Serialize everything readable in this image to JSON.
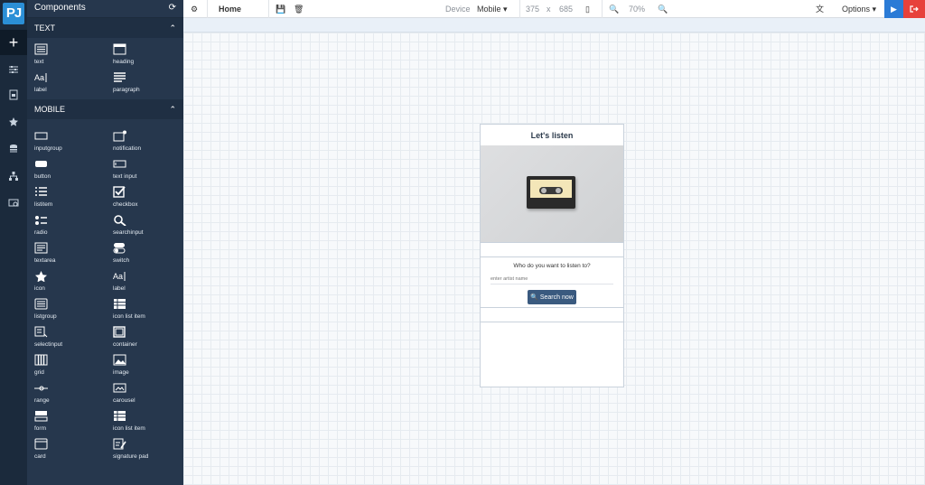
{
  "logo": "PJ",
  "rail": [
    {
      "name": "add-icon",
      "glyph": "+"
    },
    {
      "name": "sliders-icon"
    },
    {
      "name": "page-icon"
    },
    {
      "name": "star-icon"
    },
    {
      "name": "database-icon"
    },
    {
      "name": "sitemap-icon"
    },
    {
      "name": "preview-icon"
    }
  ],
  "panel": {
    "title": "Components",
    "refresh_icon": "refresh-icon"
  },
  "sections": [
    {
      "title": "TEXT",
      "items": [
        {
          "label": "text",
          "icon": "text"
        },
        {
          "label": "heading",
          "icon": "heading"
        },
        {
          "label": "label",
          "icon": "label"
        },
        {
          "label": "paragraph",
          "icon": "paragraph"
        }
      ]
    },
    {
      "title": "MOBILE",
      "items": [
        {
          "label": "inputgroup",
          "icon": "inputgroup"
        },
        {
          "label": "notification",
          "icon": "notification"
        },
        {
          "label": "button",
          "icon": "button"
        },
        {
          "label": "text input",
          "icon": "textinput"
        },
        {
          "label": "listitem",
          "icon": "list"
        },
        {
          "label": "checkbox",
          "icon": "checkbox"
        },
        {
          "label": "radio",
          "icon": "radio"
        },
        {
          "label": "searchinput",
          "icon": "search"
        },
        {
          "label": "textarea",
          "icon": "textarea"
        },
        {
          "label": "switch",
          "icon": "switch"
        },
        {
          "label": "icon",
          "icon": "star"
        },
        {
          "label": "label",
          "icon": "label"
        },
        {
          "label": "listgroup",
          "icon": "listgroup"
        },
        {
          "label": "icon list item",
          "icon": "table"
        },
        {
          "label": "selectinput",
          "icon": "selectinput"
        },
        {
          "label": "container",
          "icon": "container"
        },
        {
          "label": "grid",
          "icon": "grid"
        },
        {
          "label": "image",
          "icon": "image"
        },
        {
          "label": "range",
          "icon": "range"
        },
        {
          "label": "carousel",
          "icon": "carousel"
        },
        {
          "label": "form",
          "icon": "form"
        },
        {
          "label": "icon list item",
          "icon": "table"
        },
        {
          "label": "card",
          "icon": "card"
        },
        {
          "label": "signature pad",
          "icon": "signature"
        }
      ]
    }
  ],
  "topbar": {
    "page": "Home",
    "device_label": "Device",
    "device": "Mobile",
    "width": "375",
    "x": "x",
    "height": "685",
    "zoom": "70%",
    "options": "Options"
  },
  "mobile": {
    "title": "Let's listen",
    "question": "Who do you want to listen to?",
    "placeholder": "enter artist name",
    "button": "Search now"
  }
}
